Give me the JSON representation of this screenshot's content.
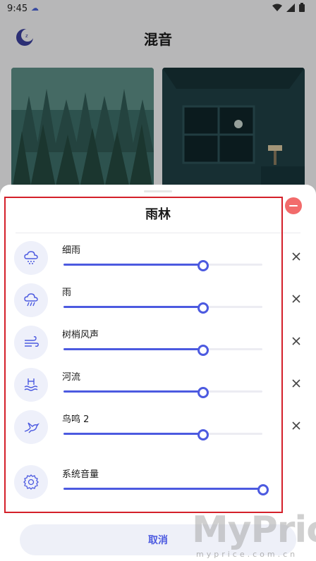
{
  "status_bar": {
    "time": "9:45",
    "cloud_icon": "cloud-icon",
    "icons": [
      "wifi-icon",
      "signal-icon",
      "battery-icon"
    ]
  },
  "header": {
    "title": "混音",
    "logo_icon": "moon-sleep-icon"
  },
  "cards": [
    {
      "name": "forest-scene"
    },
    {
      "name": "night-room-scene"
    }
  ],
  "sheet": {
    "title": "雨林",
    "sounds": [
      {
        "label": "细雨",
        "icon": "light-rain-icon",
        "level": 0.7
      },
      {
        "label": "雨",
        "icon": "rain-icon",
        "level": 0.7
      },
      {
        "label": "树梢风声",
        "icon": "wind-icon",
        "level": 0.7
      },
      {
        "label": "河流",
        "icon": "river-icon",
        "level": 0.7
      },
      {
        "label": "鸟鸣 2",
        "icon": "bird-icon",
        "level": 0.7
      }
    ],
    "system_volume": {
      "label": "系统音量",
      "icon": "gear-icon",
      "level": 1.0
    },
    "cancel_label": "取消"
  },
  "colors": {
    "accent": "#4c5ae0",
    "remove": "#f26b6b",
    "highlight": "#d4202a"
  },
  "watermark": {
    "big": "MyPrice",
    "small": "myprice.com.cn"
  }
}
